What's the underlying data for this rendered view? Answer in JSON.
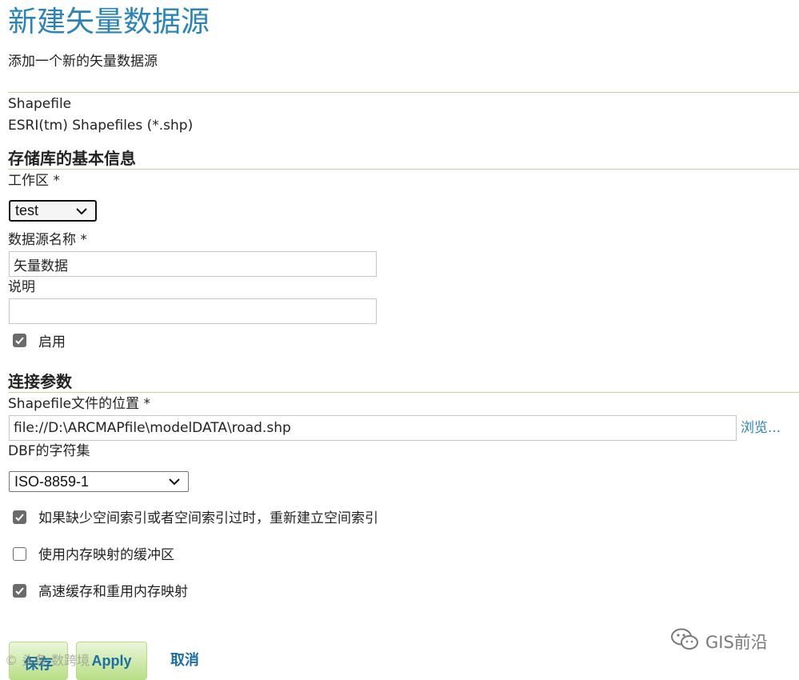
{
  "page": {
    "title": "新建矢量数据源",
    "subtitle": "添加一个新的矢量数据源"
  },
  "source_type": {
    "name": "Shapefile",
    "description": "ESRI(tm) Shapefiles (*.shp)"
  },
  "basic_info": {
    "heading": "存储库的基本信息",
    "workspace_label": "工作区 *",
    "workspace_value": "test",
    "name_label": "数据源名称 *",
    "name_value": "矢量数据",
    "description_label": "说明",
    "description_value": "",
    "enabled_label": "启用",
    "enabled_checked": true
  },
  "connection": {
    "heading": "连接参数",
    "location_label": "Shapefile文件的位置 *",
    "location_value": "file://D:\\ARCMAPfile\\modelDATA\\road.shp",
    "browse_label": "浏览...",
    "charset_label": "DBF的字符集",
    "charset_value": "ISO-8859-1",
    "options": [
      {
        "label": "如果缺少空间索引或者空间索引过时，重新建立空间索引",
        "checked": true
      },
      {
        "label": "使用内存映射的缓冲区",
        "checked": false
      },
      {
        "label": "高速缓存和重用内存映射",
        "checked": true
      }
    ]
  },
  "actions": {
    "save_label": "保存",
    "apply_label": "Apply",
    "cancel_label": "取消"
  },
  "watermark": {
    "text": "GIS前沿",
    "left_text": "© 头条 数跨境"
  },
  "colors": {
    "accent": "#2a84b8",
    "rule": "#c8d39a",
    "button_green": "#b8df86"
  }
}
